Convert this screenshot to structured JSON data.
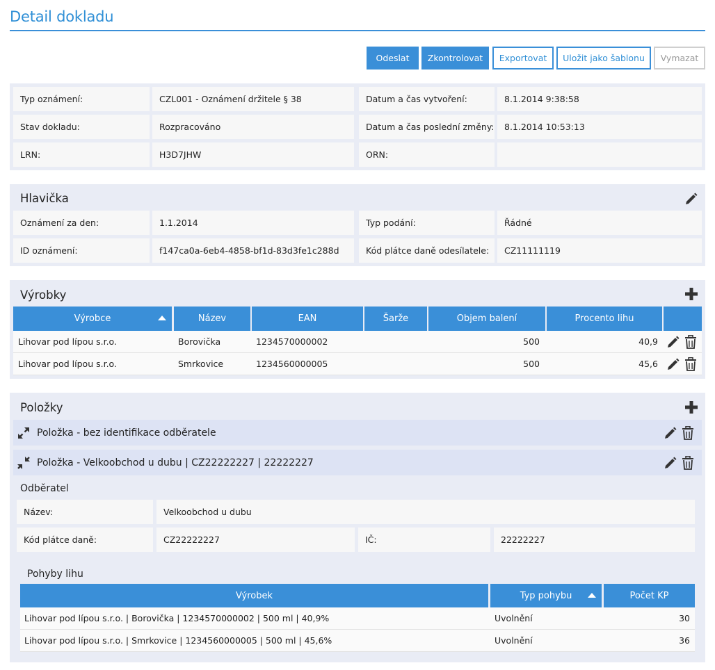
{
  "page": {
    "title": "Detail dokladu"
  },
  "toolbar": {
    "send": "Odeslat",
    "check": "Zkontrolovat",
    "export": "Exportovat",
    "save_template": "Uložit jako šablonu",
    "delete": "Vymazat"
  },
  "summary": {
    "type_label": "Typ oznámení:",
    "type_value": "CZL001 - Oznámení držitele § 38",
    "created_label": "Datum a čas vytvoření:",
    "created_value": "8.1.2014 9:38:58",
    "state_label": "Stav dokladu:",
    "state_value": "Rozpracováno",
    "modified_label": "Datum a čas poslední změny:",
    "modified_value": "8.1.2014 10:53:13",
    "lrn_label": "LRN:",
    "lrn_value": "H3D7JHW",
    "orn_label": "ORN:",
    "orn_value": ""
  },
  "header": {
    "title": "Hlavička",
    "day_label": "Oznámení za den:",
    "day_value": "1.1.2014",
    "submission_label": "Typ podání:",
    "submission_value": "Řádné",
    "id_label": "ID oznámení:",
    "id_value": "f147ca0a-6eb4-4858-bf1d-83d3fe1c288d",
    "taxcode_label": "Kód plátce daně odesílatele:",
    "taxcode_value": "CZ11111119"
  },
  "products": {
    "title": "Výrobky",
    "columns": [
      "Výrobce",
      "Název",
      "EAN",
      "Šarže",
      "Objem balení",
      "Procento lihu"
    ],
    "rows": [
      {
        "producer": "Lihovar pod lípou s.r.o.",
        "name": "Borovička",
        "ean": "1234570000002",
        "batch": "",
        "volume": "500",
        "percent": "40,9"
      },
      {
        "producer": "Lihovar pod lípou s.r.o.",
        "name": "Smrkovice",
        "ean": "1234560000005",
        "batch": "",
        "volume": "500",
        "percent": "45,6"
      }
    ]
  },
  "items": {
    "title": "Položky",
    "item1_title": "Položka - bez identifikace odběratele",
    "item2_title": "Položka - Velkoobchod u dubu | CZ22222227 | 22222227",
    "customer": {
      "title": "Odběratel",
      "name_label": "Název:",
      "name_value": "Velkoobchod u dubu",
      "tax_label": "Kód plátce daně:",
      "tax_value": "CZ22222227",
      "ic_label": "IČ:",
      "ic_value": "22222227"
    },
    "movements": {
      "title": "Pohyby lihu",
      "columns": [
        "Výrobek",
        "Typ pohybu",
        "Počet KP"
      ],
      "rows": [
        {
          "product": "Lihovar pod lípou s.r.o. | Borovička | 1234570000002 | 500 ml | 40,9%",
          "type": "Uvolnění",
          "count": "30"
        },
        {
          "product": "Lihovar pod lípou s.r.o. | Smrkovice | 1234560000005 | 500 ml | 45,6%",
          "type": "Uvolnění",
          "count": "36"
        }
      ]
    }
  },
  "colors": {
    "accent": "#3a8fd8",
    "panel": "#e9ecf5",
    "subheader": "#dde3f4",
    "cell": "#f7f7f7"
  },
  "icons": [
    "pencil-icon",
    "trash-icon",
    "plus-icon",
    "expand-icon",
    "collapse-icon",
    "sort-up-icon"
  ]
}
